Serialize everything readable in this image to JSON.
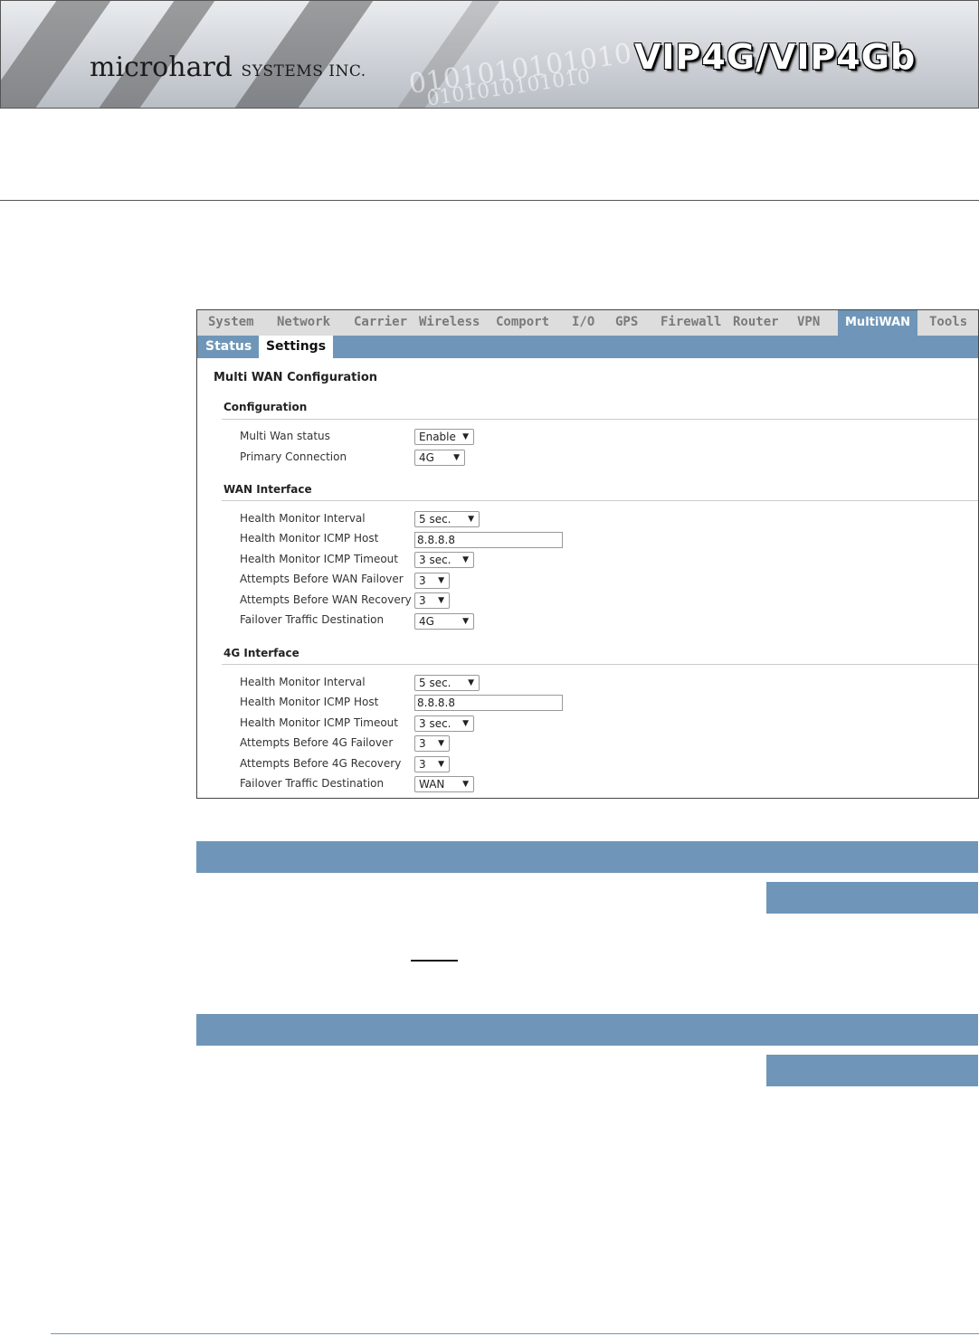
{
  "banner": {
    "brand": "microhard",
    "brand_suffix": "SYSTEMS INC.",
    "product": "VIP4G/VIP4Gb",
    "binary_a": "0101010101010",
    "binary_b": "0101010101010"
  },
  "menu": {
    "items": [
      "System",
      "Network",
      "Carrier",
      "Wireless",
      "Comport",
      "I/O",
      "GPS",
      "Firewall",
      "Router",
      "VPN",
      "MultiWAN",
      "Tools"
    ],
    "active": "MultiWAN"
  },
  "subtabs": {
    "status": "Status",
    "settings": "Settings"
  },
  "page_heading": "Multi WAN Configuration",
  "configuration": {
    "title": "Configuration",
    "multi_wan_status": {
      "label": "Multi Wan status",
      "value": "Enable"
    },
    "primary_connection": {
      "label": "Primary Connection",
      "value": "4G"
    }
  },
  "wan_interface": {
    "title": "WAN Interface",
    "health_interval": {
      "label": "Health Monitor Interval",
      "value": "5 sec."
    },
    "icmp_host": {
      "label": "Health Monitor ICMP Host",
      "value": "8.8.8.8"
    },
    "icmp_timeout": {
      "label": "Health Monitor ICMP Timeout",
      "value": "3 sec."
    },
    "attempts_failover": {
      "label": "Attempts Before WAN Failover",
      "value": "3"
    },
    "attempts_recovery": {
      "label": "Attempts Before WAN Recovery",
      "value": "3"
    },
    "failover_destination": {
      "label": "Failover Traffic Destination",
      "value": "4G"
    }
  },
  "g4_interface": {
    "title": "4G Interface",
    "health_interval": {
      "label": "Health Monitor Interval",
      "value": "5 sec."
    },
    "icmp_host": {
      "label": "Health Monitor ICMP Host",
      "value": "8.8.8.8"
    },
    "icmp_timeout": {
      "label": "Health Monitor ICMP Timeout",
      "value": "3 sec."
    },
    "attempts_failover": {
      "label": "Attempts Before 4G Failover",
      "value": "3"
    },
    "attempts_recovery": {
      "label": "Attempts Before 4G Recovery",
      "value": "3"
    },
    "failover_destination": {
      "label": "Failover Traffic Destination",
      "value": "WAN"
    }
  },
  "colors": {
    "accent": "#6f96b8",
    "menubar": "#dddddd"
  },
  "icons": {
    "dropdown": "triangle-down-icon"
  }
}
